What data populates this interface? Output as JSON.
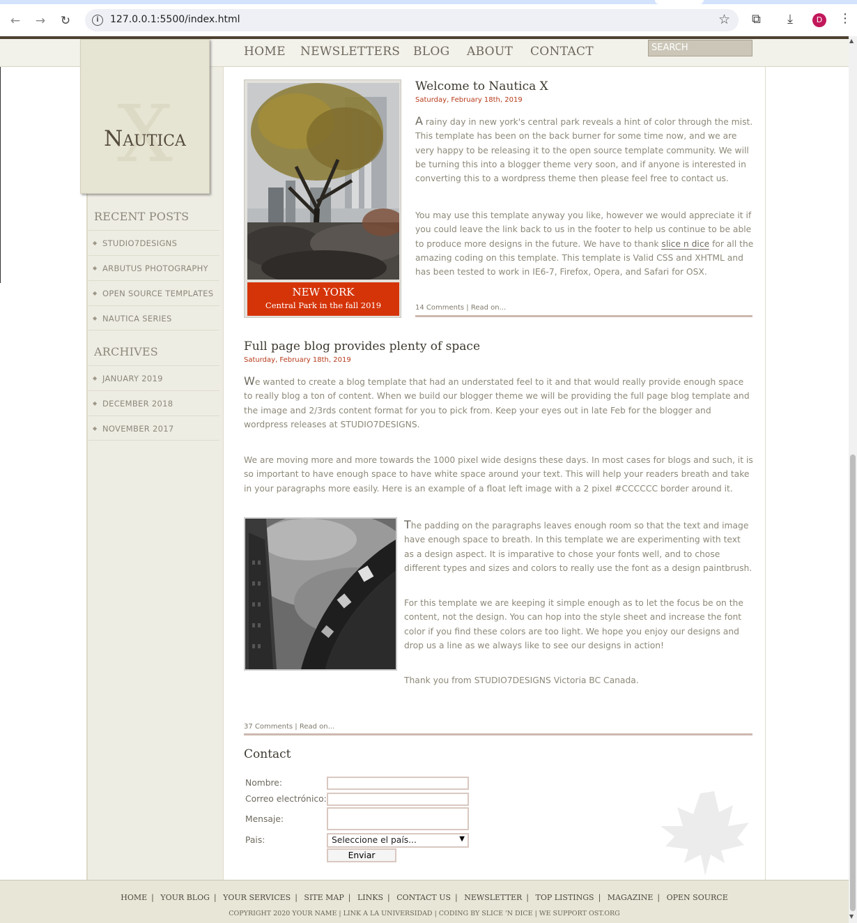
{
  "browser": {
    "url": "127.0.0.1:5500/index.html",
    "avatar_letter": "D"
  },
  "site": {
    "logo_letter": "X",
    "logo_text": "Nautica"
  },
  "nav": {
    "items": [
      "HOME",
      "NEWSLETTERS",
      "BLOG",
      "ABOUT",
      "CONTACT"
    ],
    "search_placeholder": "SEARCH"
  },
  "sidebar": {
    "recent_heading": "RECENT POSTS",
    "recent": [
      "STUDIO7DESIGNS",
      "ARBUTUS PHOTOGRAPHY",
      "OPEN SOURCE TEMPLATES",
      "NAUTICA SERIES"
    ],
    "archives_heading": "ARCHIVES",
    "archives": [
      "JANUARY 2019",
      "DECEMBER 2018",
      "NOVEMBER 2017"
    ]
  },
  "feature_photo": {
    "caption_title": "NEW YORK",
    "caption_sub": "Central Park in the fall 2019"
  },
  "post1": {
    "title": "Welcome to Nautica X",
    "date": "Saturday, February 18th, 2019",
    "p1_drop": "A",
    "p1_rest": " rainy day in new york's central park reveals a hint of color through the mist. This template has been on the back burner for some time now, and we are very happy to be releasing it to the open source template community. We will be turning this into a blogger theme very soon, and if anyone is interested in converting this to a wordpress theme then please feel free to contact us.",
    "p2_before": "You may use this template anyway you like, however we would appreciate it if you could leave the link back to us in the footer to help us continue to be able to produce more designs in the future. We have to thank ",
    "p2_link": "slice n dice",
    "p2_after": " for all the amazing coding on this template. This template is Valid CSS and XHTML and has been tested to work in IE6-7, Firefox, Opera, and Safari for OSX.",
    "comments": "14 Comments",
    "sep": "|",
    "read_on": "Read on..."
  },
  "post2": {
    "title": "Full page blog provides plenty of space",
    "date": "Saturday, February 18th, 2019",
    "p1_drop": "W",
    "p1_rest": "e wanted to create a blog template that had an understated feel to it and that would really provide enough space to really blog a ton of content. When we build our blogger theme we will be providing the full page blog template and the image and 2/3rds content format for you to pick from. Keep your eyes out in late Feb for the blogger and wordpress releases at STUDIO7DESIGNS.",
    "p2": "We are moving more and more towards the 1000 pixel wide designs these days. In most cases for blogs and such, it is so important to have enough space to have white space around your text. This will help your readers breath and take in your paragraphs more easily. Here is an example of a float left image with a 2 pixel #CCCCCC border around it.",
    "p3_drop": "T",
    "p3_rest": "he padding on the paragraphs leaves enough room so that the text and image have enough space to breath. In this template we are experimenting with text as a design aspect. It is imparative to chose your fonts well, and to chose different types and sizes and colors to really use the font as a design paintbrush.",
    "p4": "For this template we are keeping it simple enough as to let the focus be on the content, not the design. You can hop into the style sheet and increase the font color if you find these colors are too light. We hope you enjoy our designs and drop us a line as we always like to see our designs in action!",
    "p5": "Thank you from STUDIO7DESIGNS Victoria BC Canada.",
    "comments": "37 Comments",
    "sep": "|",
    "read_on": "Read on..."
  },
  "contact": {
    "heading": "Contact",
    "name_label": "Nombre:",
    "email_label": "Correo electrónico:",
    "message_label": "Mensaje:",
    "country_label": "Pais:",
    "country_selected": "Seleccione el país...",
    "submit_label": "Enviar"
  },
  "footer": {
    "links": [
      "HOME",
      "YOUR BLOG",
      "YOUR SERVICES",
      "SITE MAP",
      "LINKS",
      "CONTACT US",
      "NEWSLETTER",
      "TOP LISTINGS",
      "MAGAZINE",
      "OPEN SOURCE"
    ],
    "copyright": "COPYRIGHT 2020 YOUR NAME | LINK A LA UNIVERSIDAD | CODING BY SLICE 'N DICE | WE SUPPORT OST.ORG"
  }
}
